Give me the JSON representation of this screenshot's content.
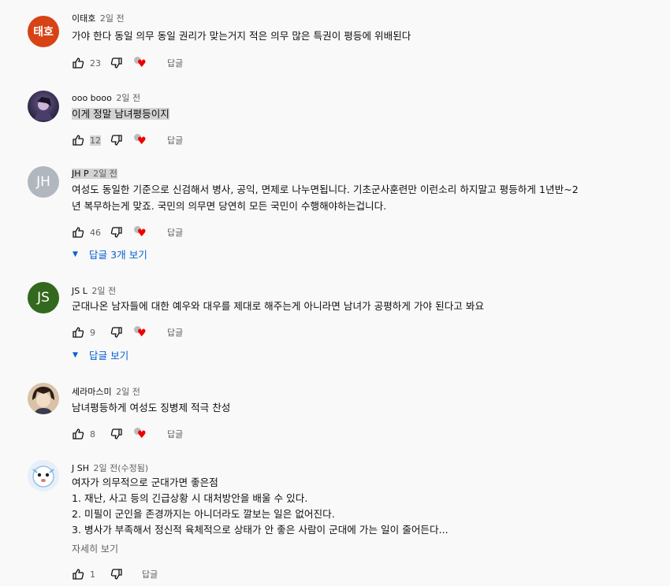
{
  "colors": {
    "accent": "#065fd4",
    "heart": "#ee0000"
  },
  "comments": [
    {
      "author": "이태호",
      "time": "2일 전",
      "avatar_text": "태호",
      "avatar_color": "#d84315",
      "lines": [
        "가야 한다 동일 의무 동일 권리가 맞는거지 적은 의무 많은 특권이 평등에 위배된다"
      ],
      "likes": "23",
      "reply_label": "답글"
    },
    {
      "author": "ooo booo",
      "time": "2일 전",
      "avatar_text": "",
      "avatar_color": "#2b2540",
      "lines": [
        "이게 정말 남녀평등이지"
      ],
      "likes": "12",
      "reply_label": "답글"
    },
    {
      "author": "JH P",
      "time": "2일 전",
      "avatar_text": "JH",
      "avatar_color": "#b0b7bf",
      "lines": [
        "여성도 동일한 기준으로 신검해서 병사, 공익, 면제로 나누면됩니다. 기초군사훈련만 이런소리 하지말고 평등하게 1년반~2",
        "년 복무하는게 맞죠. 국민의 의무면 당연히 모든 국민이 수행해야하는겁니다."
      ],
      "likes": "46",
      "reply_label": "답글",
      "replies_label": "답글 3개 보기"
    },
    {
      "author": "JS L",
      "time": "2일 전",
      "avatar_text": "JS",
      "avatar_color": "#33691e",
      "lines": [
        "군대나온 남자들에 대한 예우와 대우를 제대로 해주는게 아니라면 남녀가 공평하게 가야 된다고 봐요"
      ],
      "likes": "9",
      "reply_label": "답글",
      "replies_label": "답글 보기"
    },
    {
      "author": "세라마스미",
      "time": "2일 전",
      "avatar_text": "",
      "avatar_color": "#3e2c22",
      "lines": [
        "남녀평등하게 여성도 징병제 적극 찬성"
      ],
      "likes": "8",
      "reply_label": "답글"
    },
    {
      "author": "J SH",
      "time": "2일 전(수정됨)",
      "avatar_text": "",
      "avatar_color": "#e6f0fa",
      "lines": [
        "여자가 의무적으로 군대가면 좋은점",
        "1. 재난, 사고 등의 긴급상황 시 대처방안을 배울 수 있다.",
        "2. 미필이 군인을 존경까지는 아니더라도 깔보는 일은 없어진다.",
        "3. 병사가 부족해서 정신적 육체적으로 상태가 안 좋은 사람이 군대에 가는 일이 줄어든다..."
      ],
      "more_label": "자세히 보기",
      "likes": "1",
      "reply_label": "답글"
    }
  ]
}
